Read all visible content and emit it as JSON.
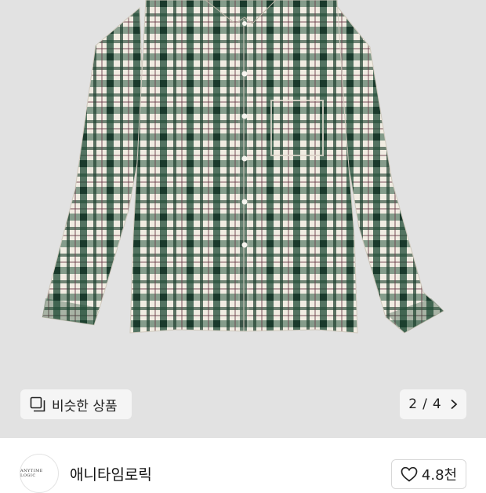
{
  "gallery": {
    "similar_label": "비슷한 상품",
    "pager": {
      "current": "2",
      "separator": "/",
      "total": "4"
    }
  },
  "seller": {
    "avatar_text": "ANYTIME LOGIC",
    "name": "애니타임로릭"
  },
  "like": {
    "count": "4.8천"
  },
  "colors": {
    "shirt_green": "#1f4a35",
    "shirt_cream": "#f1ece2",
    "background": "#e2e2e2"
  },
  "icons": [
    "stacked-squares-icon",
    "chevron-right-icon",
    "heart-icon"
  ]
}
